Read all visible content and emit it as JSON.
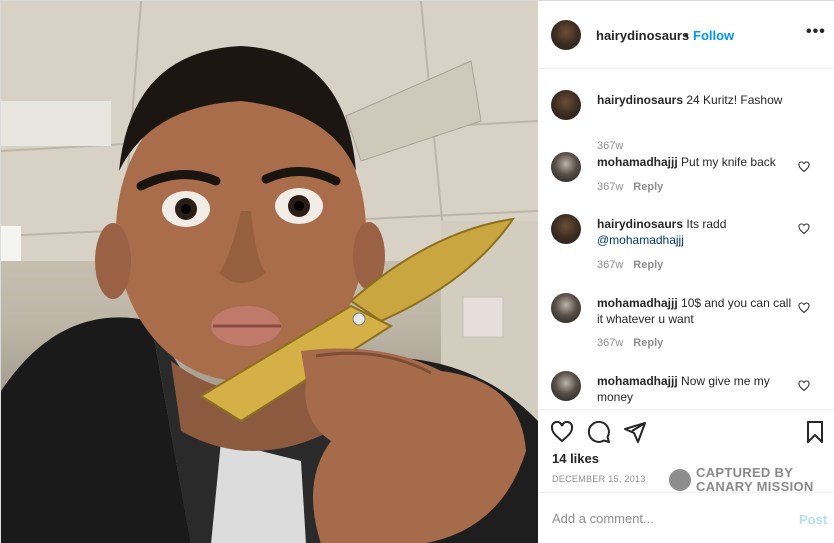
{
  "post": {
    "username": "hairydinosaurs",
    "separator": "•",
    "follow_label": "Follow",
    "more_label": "•••",
    "likes": "14 likes",
    "date": "DECEMBER 15, 2013"
  },
  "comments": [
    {
      "user": "hairydinosaurs",
      "text": "24 Kuritz! Fashow",
      "mention": "",
      "time": "367w",
      "reply": ""
    },
    {
      "user": "mohamadhajjj",
      "text": "Put my knife back",
      "mention": "",
      "time": "367w",
      "reply": "Reply"
    },
    {
      "user": "hairydinosaurs",
      "text": "Its radd",
      "mention": "@mohamadhajjj",
      "time": "367w",
      "reply": "Reply"
    },
    {
      "user": "mohamadhajjj",
      "text": "10$ and you can call it whatever u want",
      "mention": "",
      "time": "367w",
      "reply": "Reply"
    },
    {
      "user": "mohamadhajjj",
      "text": "Now give me my money",
      "mention": "",
      "time": "",
      "reply": ""
    }
  ],
  "watermark": {
    "line1": "CAPTURED BY",
    "line2": "CANARY MISSION"
  },
  "comment_box": {
    "placeholder": "Add a comment...",
    "post_label": "Post"
  },
  "icons": [
    "heart-icon",
    "comment-icon",
    "share-icon",
    "bookmark-icon",
    "more-icon",
    "like-comment-icon"
  ],
  "colors": {
    "accent": "#0095f6",
    "post_disabled": "#b2dffc",
    "meta": "#8e8e8e",
    "mention": "#00376b"
  }
}
